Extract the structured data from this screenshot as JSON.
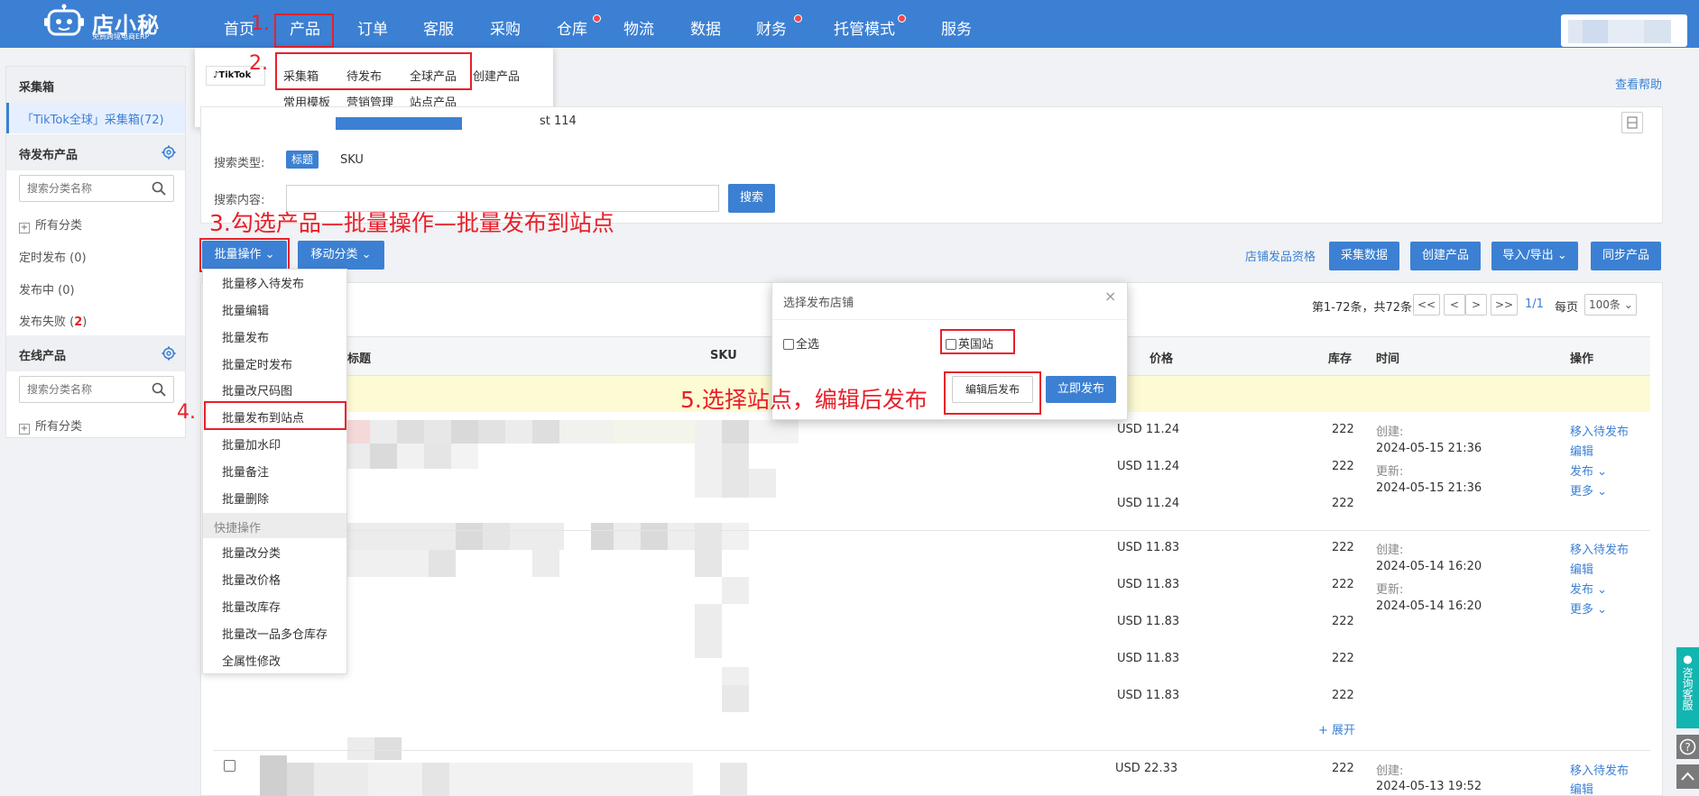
{
  "topnav": {
    "logo_name": "店小秘",
    "logo_sub": "免费跨境电商ERP",
    "items": [
      "首页",
      "产品",
      "订单",
      "客服",
      "采购",
      "仓库",
      "物流",
      "数据",
      "财务",
      "托管模式",
      "服务"
    ]
  },
  "annotations": {
    "step1": "1.",
    "step2": "2.",
    "step3": "3.勾选产品—批量操作—批量发布到站点",
    "step4": "4.",
    "step5": "5.选择站点，编辑后发布"
  },
  "product_menu": {
    "platform_tag": "TikTok",
    "links_row1": [
      "采集箱",
      "待发布",
      "全球产品",
      "创建产品"
    ],
    "links_row2": [
      "常用模板",
      "营销管理",
      "站点产品"
    ]
  },
  "sidebar": {
    "collect_header": "采集箱",
    "collect_active": "「TikTok全球」采集箱(72)",
    "pending_header": "待发布产品",
    "search_placeholder": "搜索分类名称",
    "all_category": "所有分类",
    "scheduled": "定时发布 (0)",
    "publishing": "发布中 (0)",
    "failed_label": "发布失败 (",
    "failed_count": "2",
    "failed_close": ")",
    "online_header": "在线产品"
  },
  "help_link": "查看帮助",
  "search_panel": {
    "partial_text": "st 114",
    "type_label": "搜索类型:",
    "type_title": "标题",
    "type_sku": "SKU",
    "content_label": "搜索内容:",
    "search_button": "搜索"
  },
  "toolbar": {
    "batch_button": "批量操作",
    "move_button": "移动分类",
    "shop_qualification": "店铺发品资格",
    "collect_data": "采集数据",
    "create_product": "创建产品",
    "import_export": "导入/导出",
    "sync_products": "同步产品"
  },
  "batch_menu": {
    "items": [
      "批量移入待发布",
      "批量编辑",
      "批量发布",
      "批量定时发布",
      "批量改尺码图",
      "批量发布到站点",
      "批量加水印",
      "批量备注",
      "批量删除"
    ],
    "section": "快捷操作",
    "quick_items": [
      "批量改分类",
      "批量改价格",
      "批量改库存",
      "批量改一品多仓库存",
      "全属性修改"
    ]
  },
  "pagination": {
    "summary": "第1-72条，共72条",
    "first": "<<",
    "prev": "<",
    "next": ">",
    "last": ">>",
    "page": "1/1",
    "per_page_label": "每页",
    "per_page_value": "100条"
  },
  "table": {
    "headers": {
      "title": "标题",
      "sku": "SKU",
      "price": "价格",
      "stock": "库存",
      "time": "时间",
      "action": "操作"
    },
    "group1": {
      "prices": [
        "USD 11.24",
        "USD 11.24",
        "USD 11.24"
      ],
      "stocks": [
        "222",
        "222",
        "222"
      ],
      "created_label": "创建:",
      "created": "2024-05-15 21:36",
      "updated_label": "更新:",
      "updated": "2024-05-15 21:36"
    },
    "group2": {
      "prices": [
        "USD 11.83",
        "USD 11.83",
        "USD 11.83",
        "USD 11.83",
        "USD 11.83"
      ],
      "stocks": [
        "222",
        "222",
        "222",
        "222",
        "222"
      ],
      "created_label": "创建:",
      "created": "2024-05-14 16:20",
      "updated_label": "更新:",
      "updated": "2024-05-14 16:20",
      "expand": "+ 展开"
    },
    "group3": {
      "prices": [
        "USD 22.33"
      ],
      "stocks": [
        "222"
      ],
      "created_label": "创建:",
      "created": "2024-05-13 19:52"
    },
    "actions": {
      "move": "移入待发布",
      "edit": "编辑",
      "publish": "发布",
      "more": "更多"
    }
  },
  "modal": {
    "title": "选择发布店铺",
    "select_all": "全选",
    "uk_site": "英国站",
    "edit_publish": "编辑后发布",
    "publish_now": "立即发布"
  },
  "float": {
    "service": "咨询客服"
  },
  "colors": {
    "primary": "#3c80d3",
    "annotation": "#e8202a",
    "highlight_row": "#fdfbd3"
  }
}
